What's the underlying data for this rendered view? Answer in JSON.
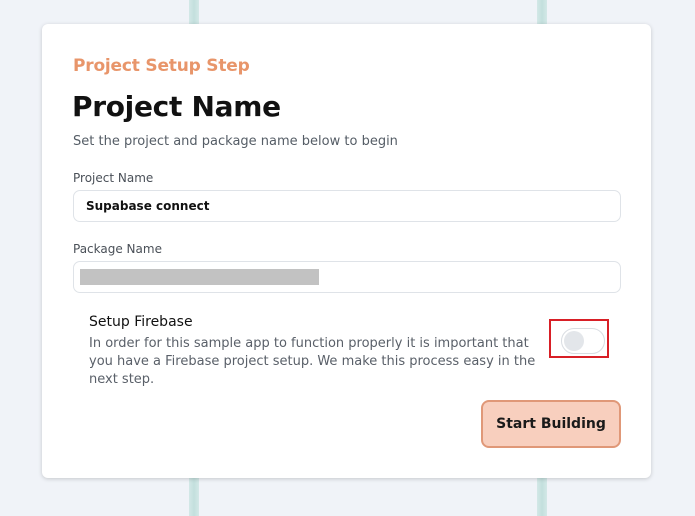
{
  "header": {
    "step_label": "Project Setup Step",
    "title": "Project Name",
    "subtitle": "Set the project and package name below to begin"
  },
  "form": {
    "project_name_label": "Project Name",
    "project_name_value": "Supabase connect",
    "package_name_label": "Package Name",
    "package_name_value": ""
  },
  "firebase": {
    "title": "Setup Firebase",
    "description": "In order for this sample app to function properly it is important that you have a Firebase project setup. We make this process easy in the next step.",
    "enabled": false
  },
  "actions": {
    "start_label": "Start Building"
  },
  "colors": {
    "accent": "#e8956a",
    "button_bg": "#f8cfbe",
    "highlight": "#d81f26"
  }
}
